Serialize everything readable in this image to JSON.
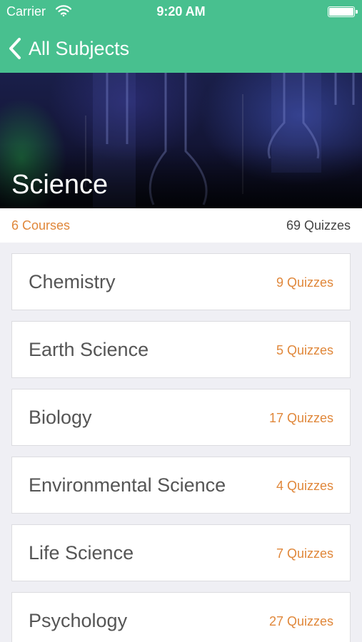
{
  "status_bar": {
    "carrier": "Carrier",
    "time": "9:20 AM"
  },
  "nav": {
    "back_label": "All Subjects"
  },
  "hero": {
    "title": "Science"
  },
  "summary": {
    "courses": "6 Courses",
    "quizzes": "69 Quizzes"
  },
  "colors": {
    "nav": "#48c08f",
    "accent": "#e0873a",
    "background": "#efeff4"
  },
  "courses": [
    {
      "name": "Chemistry",
      "quizzes": "9 Quizzes"
    },
    {
      "name": "Earth Science",
      "quizzes": "5 Quizzes"
    },
    {
      "name": "Biology",
      "quizzes": "17 Quizzes"
    },
    {
      "name": "Environmental Science",
      "quizzes": "4 Quizzes"
    },
    {
      "name": "Life Science",
      "quizzes": "7 Quizzes"
    },
    {
      "name": "Psychology",
      "quizzes": "27 Quizzes"
    }
  ]
}
